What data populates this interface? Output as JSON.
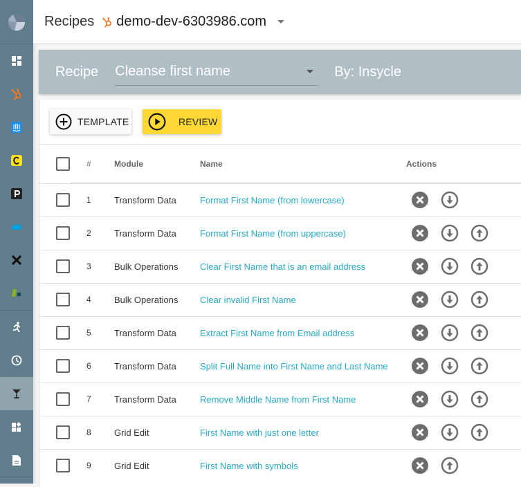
{
  "sidebar": {
    "items": [
      {
        "icon": "dashboard-icon"
      },
      {
        "icon": "hubspot-icon"
      },
      {
        "icon": "intercom-icon"
      },
      {
        "icon": "mailchimp-icon"
      },
      {
        "icon": "pipedrive-icon"
      },
      {
        "icon": "salesforce-icon"
      },
      {
        "icon": "x-icon"
      },
      {
        "icon": "brand-blocks-icon"
      },
      {
        "icon": "run-icon"
      },
      {
        "icon": "clock-icon"
      },
      {
        "icon": "recipe-glass-icon",
        "active": true
      },
      {
        "icon": "widgets-add-icon"
      },
      {
        "icon": "document-icon"
      }
    ]
  },
  "header": {
    "title": "Recipes",
    "account": "demo-dev-6303986.com"
  },
  "recipe_bar": {
    "label": "Recipe",
    "selected": "Cleanse first name",
    "author": "By: Insycle"
  },
  "toolbar": {
    "template_label": "TEMPLATE",
    "review_label": "REVIEW"
  },
  "table": {
    "headers": {
      "num": "#",
      "module": "Module",
      "name": "Name",
      "actions": "Actions"
    },
    "rows": [
      {
        "num": "1",
        "module": "Transform Data",
        "name": "Format First Name (from lowercase)",
        "actions": [
          "remove",
          "move-down"
        ]
      },
      {
        "num": "2",
        "module": "Transform Data",
        "name": "Format First Name (from uppercase)",
        "actions": [
          "remove",
          "move-down",
          "move-up"
        ]
      },
      {
        "num": "3",
        "module": "Bulk Operations",
        "name": "Clear First Name that is an email address",
        "actions": [
          "remove",
          "move-down",
          "move-up"
        ]
      },
      {
        "num": "4",
        "module": "Bulk Operations",
        "name": "Clear invalid First Name",
        "actions": [
          "remove",
          "move-down",
          "move-up"
        ]
      },
      {
        "num": "5",
        "module": "Transform Data",
        "name": "Extract First Name from Email address",
        "actions": [
          "remove",
          "move-down",
          "move-up"
        ]
      },
      {
        "num": "6",
        "module": "Transform Data",
        "name": "Split Full Name into First Name and Last Name",
        "actions": [
          "remove",
          "move-down",
          "move-up"
        ]
      },
      {
        "num": "7",
        "module": "Transform Data",
        "name": "Remove Middle Name from First Name",
        "actions": [
          "remove",
          "move-down",
          "move-up"
        ]
      },
      {
        "num": "8",
        "module": "Grid Edit",
        "name": "First Name with just one letter",
        "actions": [
          "remove",
          "move-down",
          "move-up"
        ]
      },
      {
        "num": "9",
        "module": "Grid Edit",
        "name": "First Name with symbols",
        "actions": [
          "remove",
          "move-up"
        ]
      }
    ]
  },
  "colors": {
    "sidebar": "#607d8b",
    "recipe_bar": "#b0bec5",
    "review_button": "#fdd835",
    "link": "#26a9c7",
    "action_icon": "#6d6d6d"
  }
}
